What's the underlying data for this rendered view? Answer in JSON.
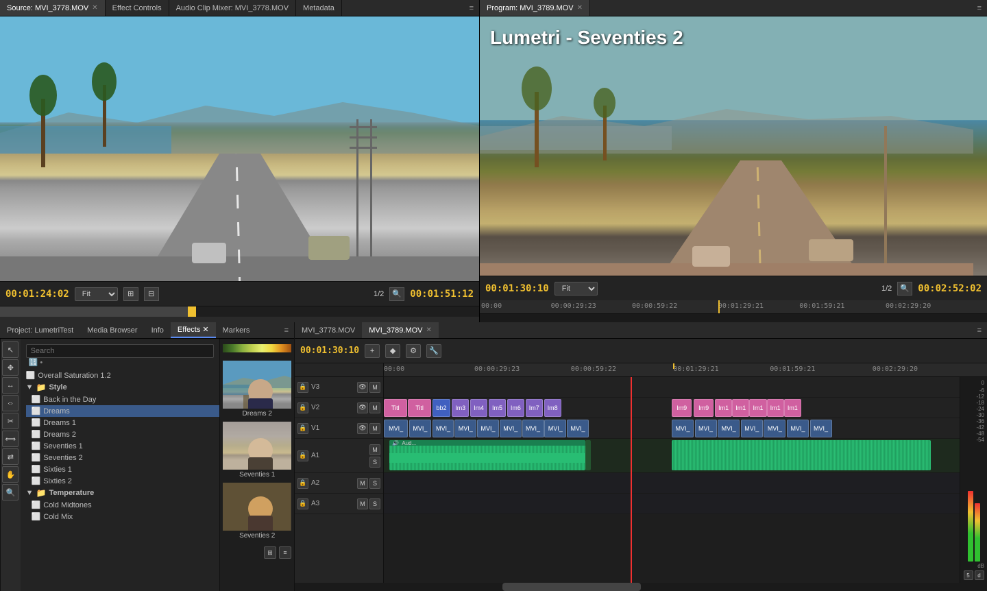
{
  "source_panel": {
    "tabs": [
      {
        "label": "Source: MVI_3778.MOV",
        "active": true,
        "closeable": true
      },
      {
        "label": "Effect Controls",
        "active": false,
        "closeable": false
      },
      {
        "label": "Audio Clip Mixer: MVI_3778.MOV",
        "active": false,
        "closeable": false
      },
      {
        "label": "Metadata",
        "active": false,
        "closeable": false
      }
    ],
    "timecode": "00:01:24:02",
    "fit_label": "Fit",
    "fraction": "1/2",
    "timecode_right": "00:01:51:12"
  },
  "program_panel": {
    "tabs": [
      {
        "label": "Program: MVI_3789.MOV",
        "active": true,
        "closeable": true
      }
    ],
    "lumetri_label": "Lumetri - Seventies 2",
    "timecode": "00:01:30:10",
    "fit_label": "Fit",
    "fraction": "1/2",
    "timecode_right": "00:02:52:02",
    "ruler": {
      "marks": [
        "00:00",
        "00:00:29:23",
        "00:00:59:22",
        "00:01:29:21",
        "00:01:59:21",
        "00:02:29:20"
      ]
    }
  },
  "effects_panel": {
    "tabs": [
      {
        "label": "Project: LumetriTest",
        "active": false
      },
      {
        "label": "Media Browser",
        "active": false
      },
      {
        "label": "Info",
        "active": false
      },
      {
        "label": "Effects",
        "active": true
      },
      {
        "label": "Markers",
        "active": false
      }
    ],
    "search_placeholder": "Search",
    "tree": [
      {
        "type": "item",
        "label": "Overall Saturation 1.2",
        "icon": "file"
      },
      {
        "type": "folder",
        "label": "Style",
        "expanded": true,
        "children": [
          {
            "type": "item",
            "label": "Back in the Day",
            "icon": "file"
          },
          {
            "type": "item",
            "label": "Dreams",
            "icon": "file",
            "selected": true
          },
          {
            "type": "item",
            "label": "Dreams 1",
            "icon": "file"
          },
          {
            "type": "item",
            "label": "Dreams 2",
            "icon": "file"
          },
          {
            "type": "item",
            "label": "Seventies 1",
            "icon": "file"
          },
          {
            "type": "item",
            "label": "Seventies 2",
            "icon": "file"
          },
          {
            "type": "item",
            "label": "Sixties 1",
            "icon": "file"
          },
          {
            "type": "item",
            "label": "Sixties 2",
            "icon": "file"
          }
        ]
      },
      {
        "type": "folder",
        "label": "Temperature",
        "expanded": true,
        "children": [
          {
            "type": "item",
            "label": "Cold Midtones",
            "icon": "file"
          },
          {
            "type": "item",
            "label": "Cold Mix",
            "icon": "file"
          }
        ]
      }
    ],
    "previews": [
      {
        "label": "Dreams 2"
      },
      {
        "label": "Seventies 1"
      },
      {
        "label": "Seventies 2"
      }
    ],
    "toolbar_tools": [
      "arrow",
      "expand",
      "razor",
      "hand",
      "zoom",
      "fit-vertical",
      "fit-horizontal",
      "full-screen"
    ]
  },
  "timeline_panel": {
    "tabs": [
      {
        "label": "MVI_3778.MOV",
        "active": false
      },
      {
        "label": "MVI_3789.MOV",
        "active": true,
        "closeable": true
      }
    ],
    "timecode": "00:01:30:10",
    "ruler_marks": [
      "00:00",
      "00:00:29:23",
      "00:00:59:22",
      "00:01:29:21",
      "00:01:59:21",
      "00:02:29:20"
    ],
    "tracks": [
      {
        "name": "V3",
        "type": "video"
      },
      {
        "name": "V2",
        "type": "video"
      },
      {
        "name": "V1",
        "type": "video"
      },
      {
        "name": "A1",
        "type": "audio"
      },
      {
        "name": "A2",
        "type": "audio"
      },
      {
        "name": "A3",
        "type": "audio"
      }
    ],
    "clips_v2": [
      "Titl",
      "Titl",
      "bb2",
      "Im3",
      "Im4",
      "Im5",
      "Im6",
      "Im7",
      "Im8",
      "Im9",
      "Im9",
      "Im1",
      "Im1",
      "Im1",
      "Im1",
      "Im1"
    ],
    "clips_v1": [
      "MVI_",
      "MVI_",
      "MVI_",
      "MVI_",
      "MVI_",
      "MVI_",
      "MVI_",
      "MVI_",
      "MVI_",
      "MVI_",
      "MVI_",
      "MVI_",
      "MVI_",
      "MVI_",
      "MVI_",
      "MVI_"
    ]
  },
  "volume_meter": {
    "labels": [
      "0",
      "-6",
      "-12",
      "-18",
      "-24",
      "-30",
      "-36",
      "-42",
      "-48",
      "-54",
      "dB"
    ]
  }
}
